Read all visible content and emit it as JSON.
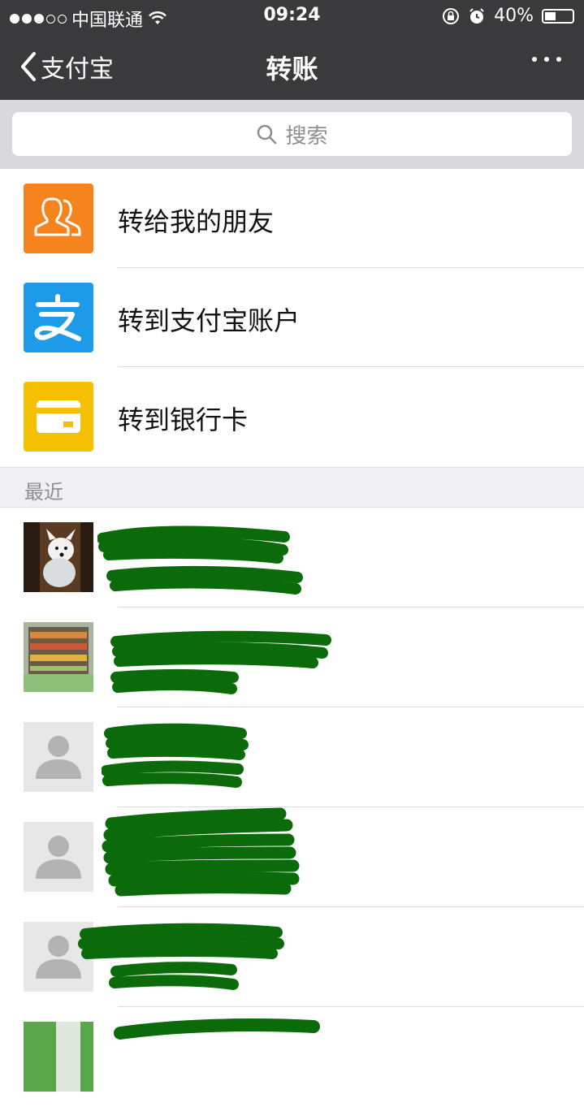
{
  "status_bar": {
    "carrier": "中国联通",
    "time": "09:24",
    "battery": "40%",
    "battery_level": 0.4
  },
  "nav": {
    "back_label": "支付宝",
    "title": "转账"
  },
  "search": {
    "placeholder": "搜索"
  },
  "menu": [
    {
      "label": "转给我的朋友",
      "icon": "friends-icon",
      "color": "#f5841f"
    },
    {
      "label": "转到支付宝账户",
      "icon": "alipay-icon",
      "color": "#1e9be8"
    },
    {
      "label": "转到银行卡",
      "icon": "bank-card-icon",
      "color": "#f5c000"
    }
  ],
  "recent": {
    "header": "最近",
    "contacts": [
      {
        "avatar": "dog-photo"
      },
      {
        "avatar": "store-photo"
      },
      {
        "avatar": "default-person-icon"
      },
      {
        "avatar": "default-person-icon"
      },
      {
        "avatar": "default-person-icon"
      },
      {
        "avatar": "green-photo"
      }
    ]
  },
  "colors": {
    "nav_bg": "#3a3a3c",
    "redaction": "#0b6b0b"
  }
}
